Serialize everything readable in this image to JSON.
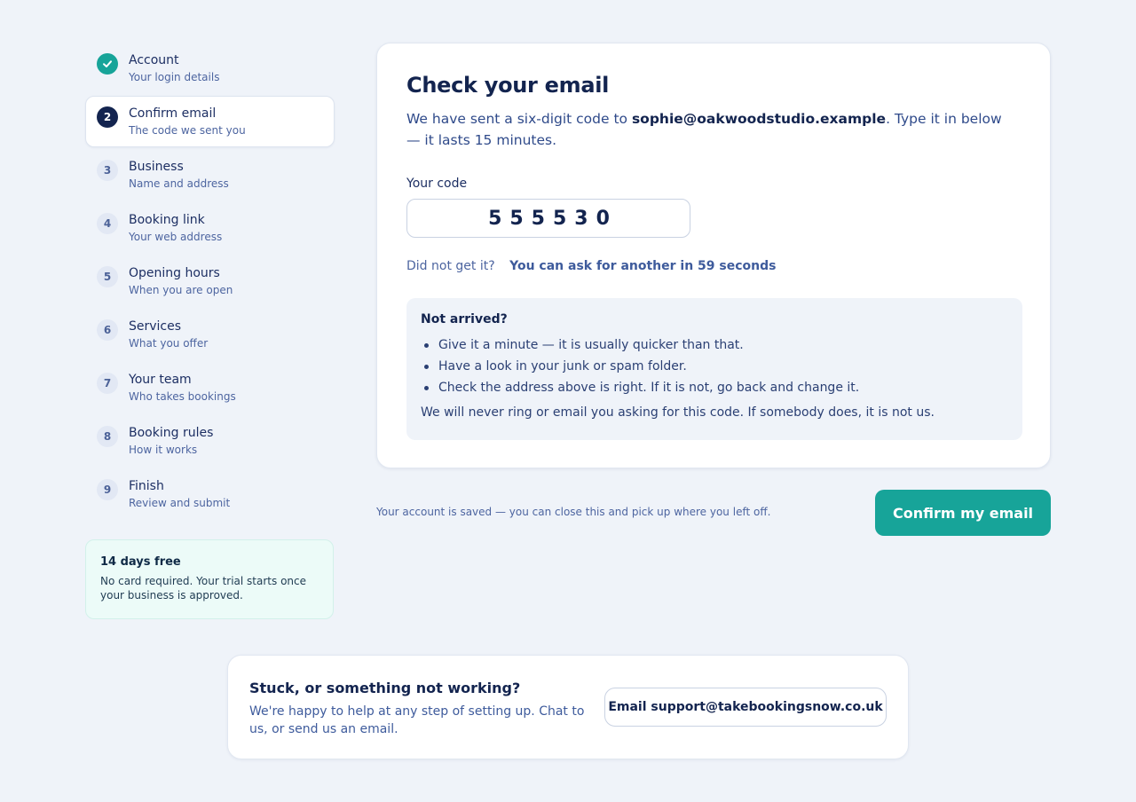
{
  "steps": [
    {
      "number": "",
      "title": "Account",
      "subtitle": "Your login details",
      "state": "done"
    },
    {
      "number": "2",
      "title": "Confirm email",
      "subtitle": "The code we sent you",
      "state": "active"
    },
    {
      "number": "3",
      "title": "Business",
      "subtitle": "Name and address",
      "state": "upcoming"
    },
    {
      "number": "4",
      "title": "Booking link",
      "subtitle": "Your web address",
      "state": "upcoming"
    },
    {
      "number": "5",
      "title": "Opening hours",
      "subtitle": "When you are open",
      "state": "upcoming"
    },
    {
      "number": "6",
      "title": "Services",
      "subtitle": "What you offer",
      "state": "upcoming"
    },
    {
      "number": "7",
      "title": "Your team",
      "subtitle": "Who takes bookings",
      "state": "upcoming"
    },
    {
      "number": "8",
      "title": "Booking rules",
      "subtitle": "How it works",
      "state": "upcoming"
    },
    {
      "number": "9",
      "title": "Finish",
      "subtitle": "Review and submit",
      "state": "upcoming"
    }
  ],
  "trial": {
    "title": "14 days free",
    "text": "No card required. Your trial starts once your business is approved."
  },
  "card": {
    "title": "Check your email",
    "intro_before": "We have sent a six-digit code to ",
    "email": "sophie@oakwoodstudio.example",
    "intro_after": ". Type it in below — it lasts 15 minutes.",
    "code_label": "Your code",
    "code_value": "555530",
    "resend_question": "Did not get it?",
    "resend_link": "You can ask for another in 59 seconds",
    "help": {
      "title": "Not arrived?",
      "items": [
        "Give it a minute — it is usually quicker than that.",
        "Have a look in your junk or spam folder.",
        "Check the address above is right. If it is not, go back and change it."
      ],
      "note": "We will never ring or email you asking for this code. If somebody does, it is not us."
    }
  },
  "footer": {
    "saved_note": "Your account is saved — you can close this and pick up where you left off.",
    "confirm_label": "Confirm my email"
  },
  "support": {
    "title": "Stuck, or something not working?",
    "text": "We're happy to help at any step of setting up. Chat to us, or send us an email.",
    "button_label": "Email support@takebookingsnow.co.uk"
  },
  "colors": {
    "accent": "#17a499",
    "navy": "#13244f",
    "background": "#eff3f9"
  }
}
